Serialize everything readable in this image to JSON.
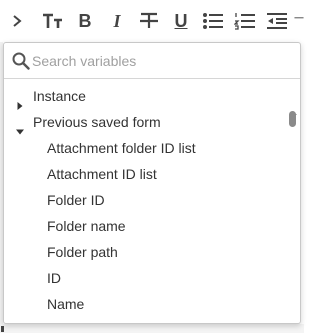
{
  "toolbar": {
    "buttons": [
      "expand-toolbar",
      "font-size",
      "bold",
      "italic",
      "strikethrough",
      "underline",
      "bullet-list",
      "numbered-list",
      "outdent",
      "indent"
    ],
    "bold_label": "B",
    "italic_label": "I",
    "underline_label": "U"
  },
  "search": {
    "placeholder": "Search variables",
    "value": ""
  },
  "tree": {
    "groups": [
      {
        "label": "Instance",
        "expanded": false,
        "items": []
      },
      {
        "label": "Previous saved form",
        "expanded": true,
        "items": [
          "Attachment folder ID list",
          "Attachment ID list",
          "Folder ID",
          "Folder name",
          "Folder path",
          "ID",
          "Name"
        ]
      }
    ]
  }
}
